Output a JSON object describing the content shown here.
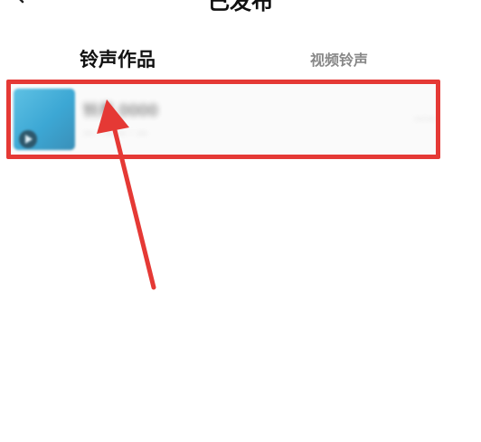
{
  "header": {
    "title": "已发布",
    "back_icon": "chevron-left-icon"
  },
  "tabs": [
    {
      "label": "铃声作品",
      "active": true
    },
    {
      "label": "视频铃声",
      "active": false
    }
  ],
  "items": [
    {
      "title": "铃声 0000",
      "meta": "—  ·  ——  ·  —",
      "side": "——",
      "thumbnail_icon": "play-icon"
    }
  ],
  "annotation": {
    "color": "#e53935",
    "shapes": [
      "red-box",
      "red-arrow"
    ]
  }
}
